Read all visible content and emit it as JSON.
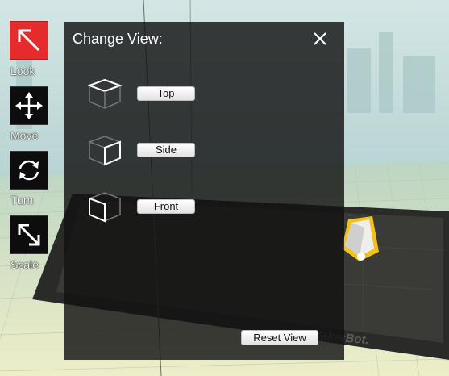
{
  "tools": [
    {
      "label": "Look",
      "icon": "look-arrow-icon",
      "active": true
    },
    {
      "label": "Move",
      "icon": "move-arrows-icon",
      "active": false
    },
    {
      "label": "Turn",
      "icon": "turn-arrows-icon",
      "active": false
    },
    {
      "label": "Scale",
      "icon": "scale-arrow-icon",
      "active": false
    }
  ],
  "panel": {
    "title": "Change View:",
    "close_icon": "close-icon",
    "views": [
      {
        "label": "Top",
        "icon": "cube-top-icon"
      },
      {
        "label": "Side",
        "icon": "cube-side-icon"
      },
      {
        "label": "Front",
        "icon": "cube-front-icon"
      }
    ],
    "reset_label": "Reset View"
  },
  "build_plate": {
    "logo": "MakerBot."
  },
  "colors": {
    "active_tool": "#e52b2b",
    "panel_bg": "#121212",
    "sky": "#bcd7d6",
    "grid_floor": "#eaecc6",
    "selection_outline": "#f2c21a"
  }
}
